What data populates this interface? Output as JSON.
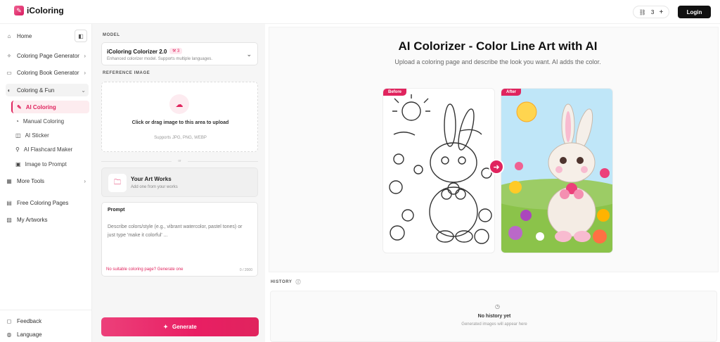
{
  "app": {
    "name": "iColoring",
    "credits": "3",
    "login_label": "Login"
  },
  "sidebar": {
    "items": [
      {
        "label": "Home",
        "icon": "home-icon"
      },
      {
        "label": "Coloring Page Generator",
        "icon": "sparkle-icon"
      },
      {
        "label": "Coloring Book Generator",
        "icon": "book-icon"
      },
      {
        "label": "Coloring & Fun",
        "icon": "palette-icon"
      },
      {
        "label": "More Tools",
        "icon": "grid-icon"
      },
      {
        "label": "Free Coloring Pages",
        "icon": "pages-icon"
      },
      {
        "label": "My Artworks",
        "icon": "image-icon"
      }
    ],
    "sub_items": [
      {
        "label": "AI Coloring",
        "active": true
      },
      {
        "label": "Manual Coloring"
      },
      {
        "label": "AI Sticker"
      },
      {
        "label": "AI Flashcard Maker"
      },
      {
        "label": "Image to Prompt"
      }
    ],
    "footer": [
      {
        "label": "Feedback",
        "icon": "chat-icon"
      },
      {
        "label": "Language",
        "icon": "globe-icon"
      }
    ]
  },
  "panel": {
    "model_label": "MODEL",
    "model_name": "iColoring Colorizer 2.0",
    "model_badge": "3",
    "model_desc": "Enhanced colorizer model. Supports multiple languages.",
    "reference_label": "REFERENCE IMAGE",
    "upload_title": "Click or drag image to this area to upload",
    "upload_sub": "Supports JPG, PNG, WEBP",
    "or_label": "or",
    "artworks_title": "Your Art Works",
    "artworks_sub": "Add one from your works",
    "prompt_title": "Prompt",
    "prompt_placeholder": "Describe colors/style (e.g., vibrant watercolor, pastel tones) or just type 'make it colorful' ...",
    "prompt_link": "No suitable coloring page? Generate one",
    "prompt_count": "0 / 2000",
    "generate_label": "Generate"
  },
  "main": {
    "title": "AI Colorizer - Color Line Art with AI",
    "subtitle": "Upload a coloring page and describe the look you want. AI adds the color.",
    "before_tag": "Before",
    "after_tag": "After",
    "history_label": "HISTORY",
    "history_empty_title": "No history yet",
    "history_empty_sub": "Generated images will appear here"
  },
  "colors": {
    "accent": "#e0245e",
    "sky": "#bfe6f8",
    "grass": "#8bc34a"
  }
}
